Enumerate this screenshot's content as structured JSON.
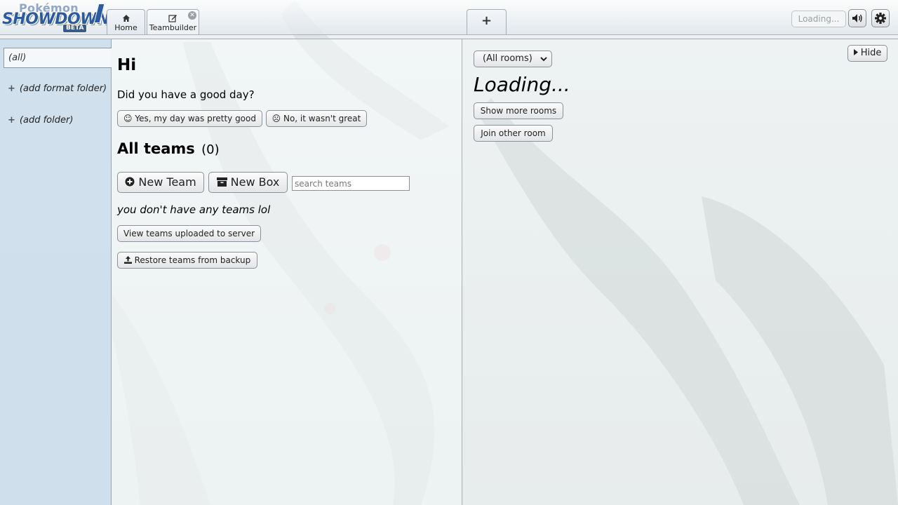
{
  "header": {
    "logo": {
      "line1": "Pokémon",
      "line2": "SHOWDOWN",
      "badge": "BETA"
    },
    "tabs": [
      {
        "label": "Home",
        "icon": "home-icon"
      },
      {
        "label": "Teambuilder",
        "icon": "edit-icon",
        "close_icon": "close-icon"
      }
    ],
    "add_tab_label": "+",
    "loading_button": "Loading...",
    "volume_icon": "volume-icon",
    "settings_icon": "gear-icon"
  },
  "sidebar": {
    "all_folder": "(all)",
    "add_format_folder": "(add format folder)",
    "add_folder": "(add folder)",
    "plus": "+"
  },
  "main": {
    "greeting": "Hi",
    "question": "Did you have a good day?",
    "yes_button": "Yes, my day was pretty good",
    "no_button": "No, it wasn't great",
    "teams_title": "All teams",
    "teams_count": "(0)",
    "new_team_button": "New Team",
    "new_box_button": "New Box",
    "search_placeholder": "search teams",
    "empty_text": "you don't have any teams lol",
    "view_uploaded_button": "View teams uploaded to server",
    "restore_button": "Restore teams from backup"
  },
  "rooms": {
    "filter_selected": "(All rooms)",
    "hide_button": "Hide",
    "loading_text": "Loading...",
    "show_more_button": "Show more rooms",
    "join_other_button": "Join other room"
  }
}
